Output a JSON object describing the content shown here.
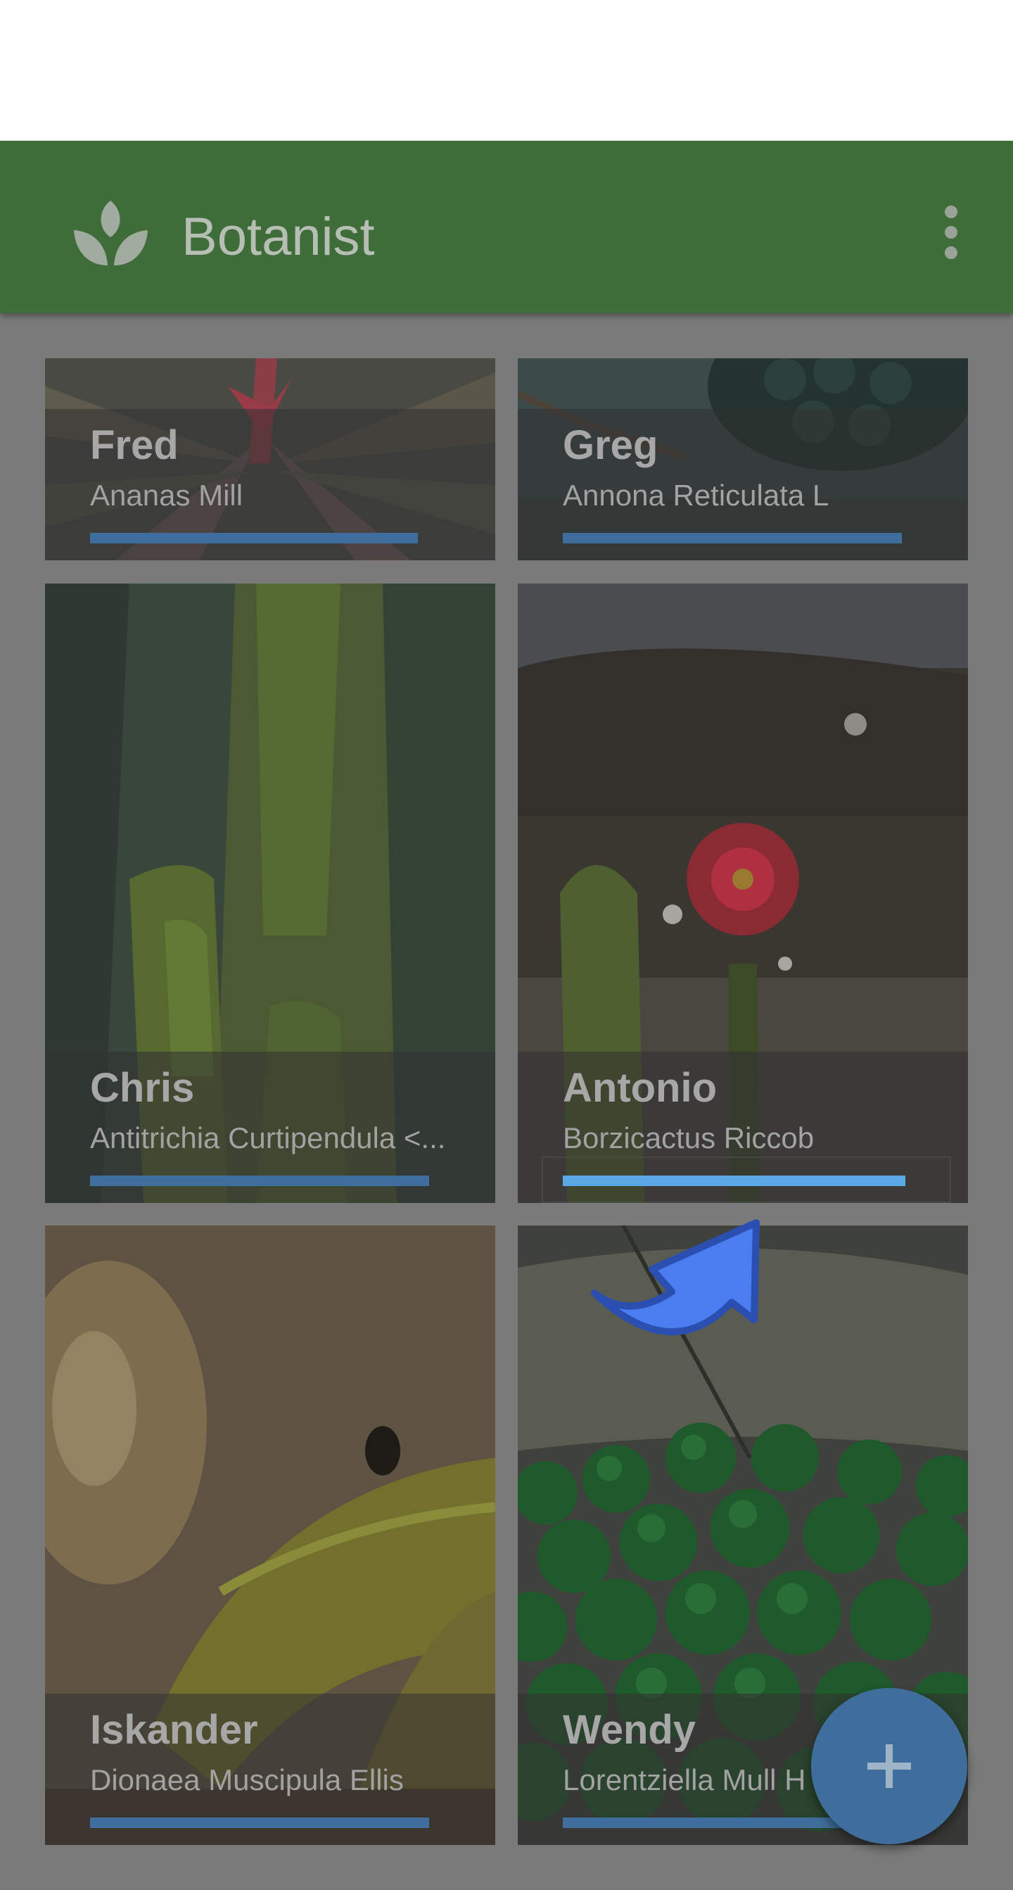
{
  "app_bar": {
    "title": "Botanist",
    "logo_icon": "leaf-sprout-icon",
    "menu_icon": "more-vertical-icon",
    "color": "#3f6d3a"
  },
  "plants": [
    {
      "name": "Fred",
      "species": "Ananas Mill",
      "progress": 0.92,
      "image": "bromeliad-photo"
    },
    {
      "name": "Greg",
      "species": "Annona Reticulata L",
      "progress": 0.95,
      "image": "custard-apple-photo"
    },
    {
      "name": "Chris",
      "species": "Antitrichia Curtipendula <...",
      "progress": 0.95,
      "image": "moss-tree-photo"
    },
    {
      "name": "Antonio",
      "species": "Borzicactus Riccob",
      "progress": 0.96,
      "image": "cactus-flower-photo",
      "highlighted": true
    },
    {
      "name": "Iskander",
      "species": "Dionaea Muscipula Ellis",
      "progress": 0.95,
      "image": "venus-flytrap-photo"
    },
    {
      "name": "Wendy",
      "species": "Lorentziella Mull H",
      "progress": 0.95,
      "image": "moss-balls-photo"
    }
  ],
  "fab": {
    "icon": "plus-icon",
    "color": "#3f6e9c"
  },
  "overlay": {
    "gesture_icon": "swipe-arrow-icon",
    "arrow_color": "#4a7df0"
  }
}
